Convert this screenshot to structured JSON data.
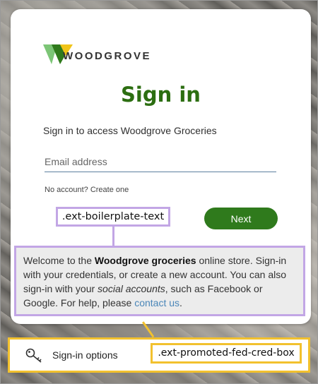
{
  "brand": {
    "logo_text": "WOODGROVE",
    "colors": {
      "green": "#2f7a1c",
      "title_green": "#2c6e11",
      "light_green": "#7cc576",
      "yellow": "#f0c419"
    }
  },
  "signin": {
    "title": "Sign in",
    "subtitle": "Sign in to access Woodgrove Groceries",
    "email_placeholder": "Email address",
    "no_account_text": "No account?",
    "create_link": "Create one",
    "next_label": "Next"
  },
  "annotations": {
    "boilerplate_label": ".ext-boilerplate-text",
    "fed_box_label": ".ext-promoted-fed-cred-box",
    "purple": "#c2a6e5",
    "yellow": "#f2c12e"
  },
  "boilerplate": {
    "part1": "Welcome to the ",
    "bold": "Woodgrove groceries",
    "part2": " online store. Sign-in with your credentials, or create a new account. You can also sign-in with your ",
    "italic": "social accounts",
    "part3": ", such as Facebook or Google. For help, please ",
    "link": "contact us",
    "part4": "."
  },
  "fed_options": {
    "label": "Sign-in options",
    "icon": "key-icon"
  }
}
